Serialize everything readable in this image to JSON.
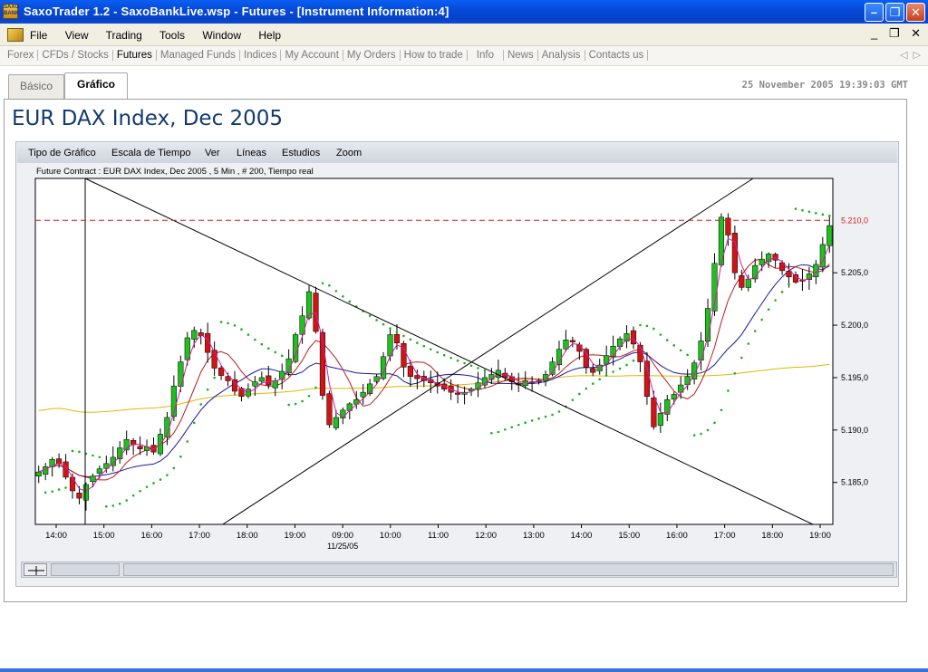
{
  "window": {
    "title": "SaxoTrader 1.2 - SaxoBankLive.wsp - Futures - [Instrument Information:4]",
    "icon_text": "SAXO BANK",
    "buttons": [
      "minimize-icon",
      "restore-icon",
      "close-icon"
    ]
  },
  "menu": {
    "items": [
      "File",
      "View",
      "Trading",
      "Tools",
      "Window",
      "Help"
    ],
    "mdi_controls": [
      "_",
      "❐",
      "✕"
    ]
  },
  "nav": {
    "items": [
      "Forex",
      "CFDs / Stocks",
      "Futures",
      "Managed Funds",
      "Indices",
      "My Account",
      "My Orders",
      "How to trade",
      "Info",
      "News",
      "Analysis",
      "Contacts us"
    ],
    "active": "Futures",
    "arrows": [
      "◁",
      "▷"
    ]
  },
  "tabs": [
    {
      "label": "Básico",
      "active": false
    },
    {
      "label": "Gráfico",
      "active": true
    }
  ],
  "timestamp": "25 November 2005 19:39:03 GMT",
  "page_title": "EUR DAX Index, Dec 2005",
  "chart_toolbar": [
    "Tipo de Gráfico",
    "Escala de Tiempo",
    "Ver",
    "Líneas",
    "Estudios",
    "Zoom"
  ],
  "chart_info": "Future Contract : EUR DAX Index, Dec 2005 , 5 Min , # 200, Tiempo real",
  "chart_data": {
    "type": "candlestick",
    "title": "",
    "x_labels": [
      "14:00",
      "15:00",
      "16:00",
      "17:00",
      "18:00",
      "19:00",
      "09:00",
      "10:00",
      "11:00",
      "12:00",
      "13:00",
      "14:00",
      "15:00",
      "16:00",
      "17:00",
      "18:00",
      "19:00"
    ],
    "date_label": "11/25/05",
    "y_ticks": [
      "5.185,0",
      "5.190,0",
      "5.195,0",
      "5.200,0",
      "5.210,0",
      "5.205,0"
    ],
    "y_tick_values": [
      5185,
      5190,
      5195,
      5200,
      5210,
      5205
    ],
    "ylim": [
      5181,
      5214
    ],
    "reference_line": {
      "value": 5210,
      "label": "5.210,0",
      "color": "#d22020",
      "style": "dashed"
    },
    "series_close": [
      5186,
      5186.5,
      5187.2,
      5186.8,
      5185.5,
      5184.2,
      5183.5,
      5184.8,
      5185.6,
      5186.3,
      5186.8,
      5187.4,
      5188.3,
      5189.1,
      5188.6,
      5188.2,
      5188.4,
      5187.9,
      5189.6,
      5191.2,
      5194.2,
      5196.5,
      5198.8,
      5199.5,
      5199,
      5197.4,
      5195.9,
      5195.2,
      5194.7,
      5193.7,
      5193.2,
      5193.9,
      5194.6,
      5195,
      5194.3,
      5194.7,
      5195.6,
      5196.8,
      5199.1,
      5200.9,
      5203.2,
      5199.4,
      5193.3,
      5190.5,
      5191.2,
      5191.9,
      5192.5,
      5192.9,
      5193.6,
      5194.4,
      5195.1,
      5197,
      5199.1,
      5198.3,
      5196,
      5195.1,
      5194.9,
      5194.7,
      5194.5,
      5194.2,
      5193.9,
      5193.6,
      5193.4,
      5193.6,
      5193.9,
      5194.5,
      5195,
      5195.3,
      5195.7,
      5195,
      5194.6,
      5194.3,
      5194.7,
      5194.6,
      5194.7,
      5195.3,
      5196.5,
      5197.7,
      5198.6,
      5198.4,
      5197.5,
      5196,
      5195.5,
      5196.2,
      5197.1,
      5198,
      5198.7,
      5199.2,
      5198.2,
      5196.5,
      5193.2,
      5190.3,
      5191.6,
      5192.9,
      5193.4,
      5194.3,
      5195.1,
      5196.4,
      5198.5,
      5201.6,
      5205.9,
      5210.3,
      5208.6,
      5205,
      5203.6,
      5204.4,
      5205.7,
      5206.3,
      5206.8,
      5206.2,
      5205.2,
      5204.6,
      5204.1,
      5204.2,
      5204.9,
      5205.8,
      5207.7,
      5209.5
    ],
    "overlays": [
      {
        "name": "",
        "kind": "moving-average-fast",
        "color": "#d11f9a"
      },
      {
        "name": "",
        "kind": "moving-average-medium",
        "color": "#b81c1c"
      },
      {
        "name": "",
        "kind": "moving-average-slow",
        "color": "#1818a8"
      },
      {
        "name": "",
        "kind": "moving-average-long",
        "color": "#e0b800"
      },
      {
        "name": "",
        "kind": "parabolic-sar",
        "color": "#17b217"
      }
    ],
    "trendlines": [
      {
        "from": [
          0.0625,
          5214
        ],
        "to": [
          0.975,
          5181
        ]
      },
      {
        "from": [
          0.235,
          5181
        ],
        "to": [
          0.9,
          5214
        ]
      }
    ],
    "colors": {
      "up": "#1fbf1f",
      "down": "#d01414",
      "frame": "#000000",
      "background": "#ffffff"
    }
  }
}
